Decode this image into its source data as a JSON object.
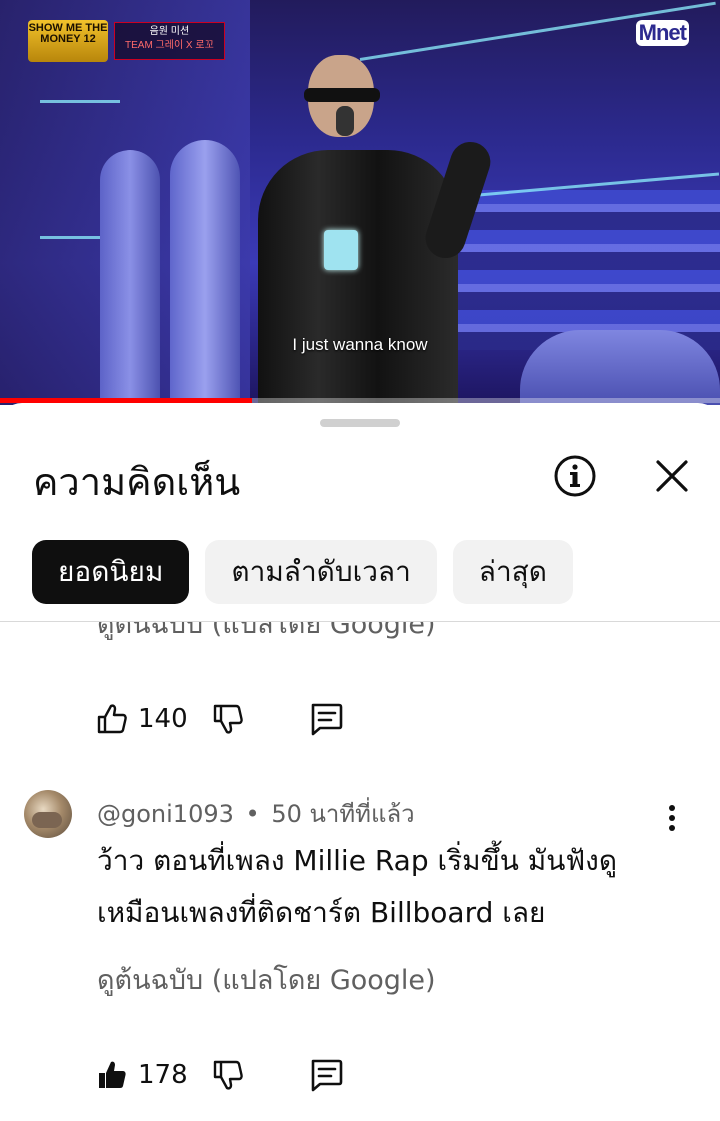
{
  "video": {
    "show_logo_text": "SHOW ME THE MONEY 12",
    "mission_label": "음원 미션",
    "team_label": "TEAM 그레이 X 로꼬",
    "channel_logo": "Mnet",
    "caption": "I just wanna know",
    "progress_fraction": 0.35,
    "progress_color": "#ff0000"
  },
  "sheet": {
    "title": "ความคิดเห็น",
    "info_icon": "info-icon",
    "close_icon": "close-icon",
    "chips": [
      {
        "label": "ยอดนิยม",
        "active": true
      },
      {
        "label": "ตามลำดับเวลา",
        "active": false
      },
      {
        "label": "ล่าสุด",
        "active": false
      }
    ]
  },
  "comments": {
    "partial": {
      "translate_text": "ดูต้นฉบับ (แปลโดย Google)",
      "like_count": "140"
    },
    "items": [
      {
        "author": "@goni1093",
        "separator": "•",
        "time": "50 นาทีที่แล้ว",
        "text": "ว้าว ตอนที่เพลง Millie Rap เริ่มขึ้น มันฟังดูเหมือนเพลงที่ติดชาร์ต Billboard เลย",
        "translate_text": "ดูต้นฉบับ (แปลโดย Google)",
        "like_count": "178",
        "liked": true
      }
    ]
  },
  "colors": {
    "text_primary": "#0f0f0f",
    "text_secondary": "#606060",
    "chip_bg": "#f2f2f2",
    "chip_active_bg": "#0f0f0f"
  }
}
